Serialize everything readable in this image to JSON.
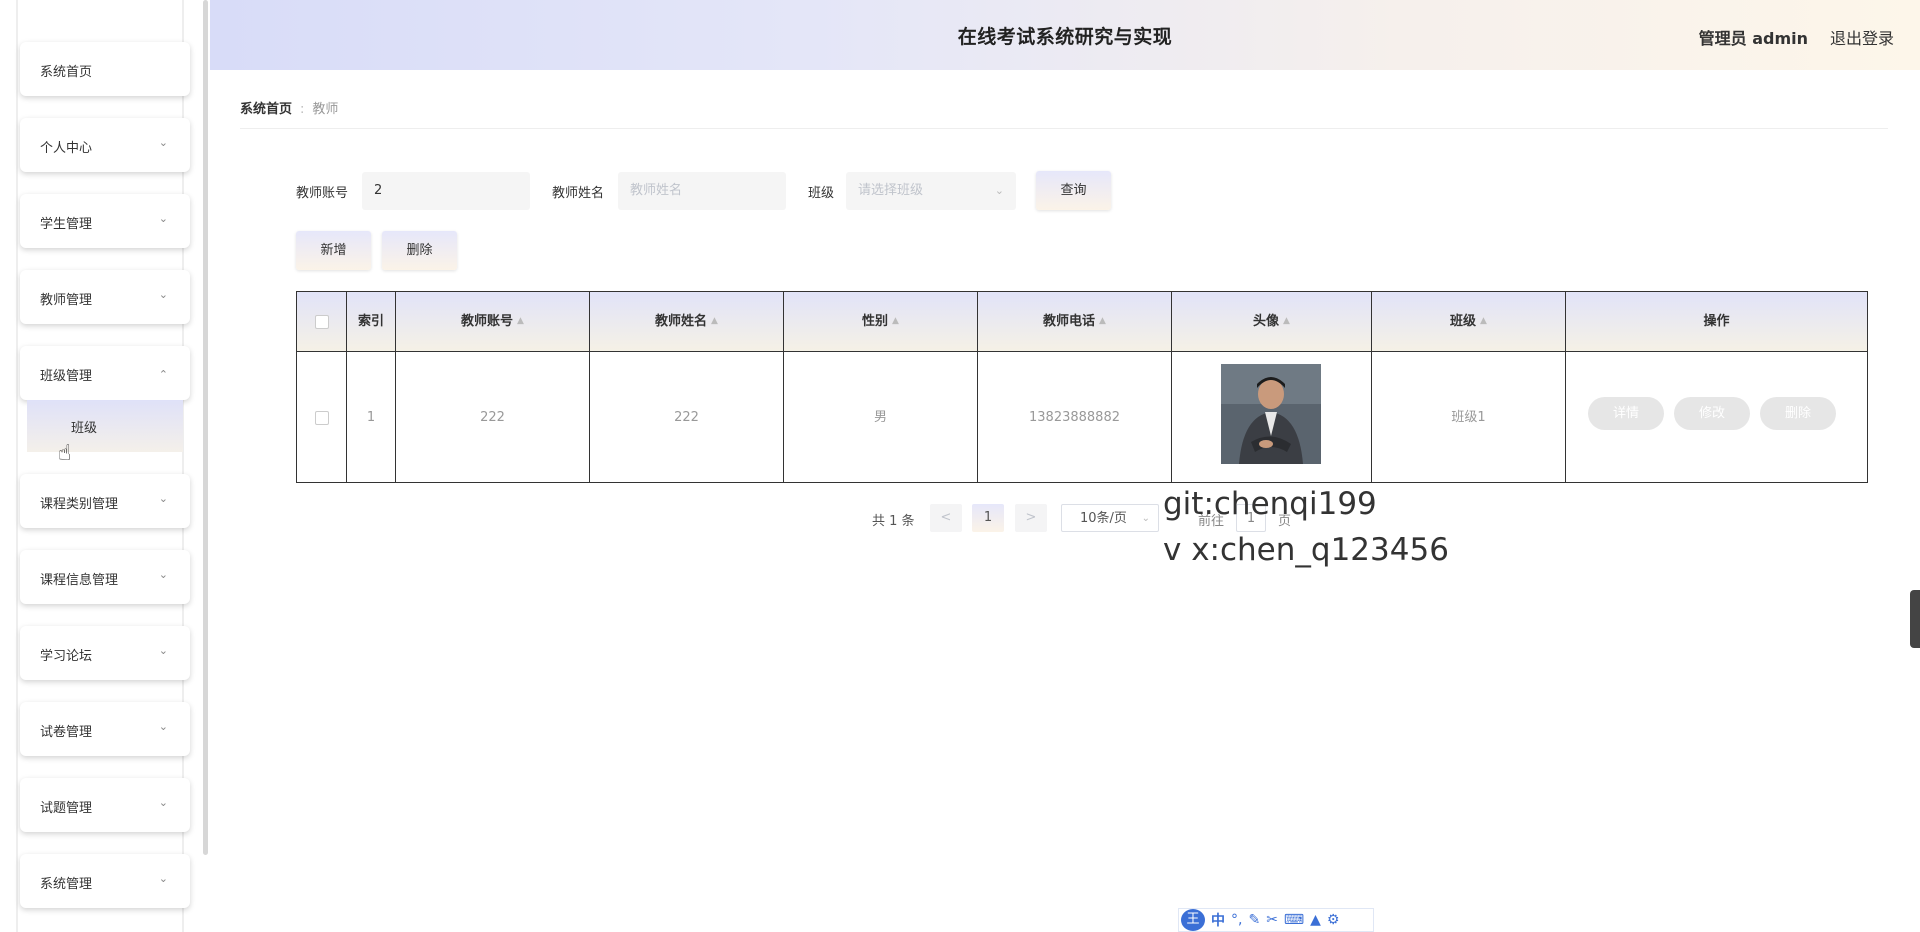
{
  "header": {
    "title": "在线考试系统研究与实现",
    "user_label": "管理员 admin",
    "logout_label": "退出登录"
  },
  "sidebar": {
    "items": [
      {
        "label": "系统首页",
        "has_chevron": false
      },
      {
        "label": "个人中心",
        "has_chevron": true
      },
      {
        "label": "学生管理",
        "has_chevron": true
      },
      {
        "label": "教师管理",
        "has_chevron": true
      },
      {
        "label": "班级管理",
        "has_chevron": true,
        "expanded": true
      },
      {
        "label": "课程类别管理",
        "has_chevron": true
      },
      {
        "label": "课程信息管理",
        "has_chevron": true
      },
      {
        "label": "学习论坛",
        "has_chevron": true
      },
      {
        "label": "试卷管理",
        "has_chevron": true
      },
      {
        "label": "试题管理",
        "has_chevron": true
      },
      {
        "label": "系统管理",
        "has_chevron": true
      }
    ],
    "subitem": {
      "label": "班级"
    }
  },
  "breadcrumb": {
    "home": "系统首页",
    "separator": ":",
    "current": "教师"
  },
  "search": {
    "account_label": "教师账号",
    "account_value": "2",
    "name_label": "教师姓名",
    "name_placeholder": "教师姓名",
    "class_label": "班级",
    "class_placeholder": "请选择班级",
    "query_button": "查询"
  },
  "actions": {
    "add_button": "新增",
    "delete_button": "删除"
  },
  "table": {
    "headers": [
      "索引",
      "教师账号",
      "教师姓名",
      "性别",
      "教师电话",
      "头像",
      "班级",
      "操作"
    ],
    "rows": [
      {
        "index": "1",
        "account": "222",
        "name": "222",
        "gender": "男",
        "phone": "13823888882",
        "avatar": "teacher-photo",
        "class": "班级1"
      }
    ],
    "row_buttons": [
      "详情",
      "修改",
      "删除"
    ]
  },
  "pagination": {
    "total": "共 1 条",
    "prev": "<",
    "current_page": "1",
    "next": ">",
    "page_size": "10条/页",
    "goto_label": "前往",
    "goto_value": "1",
    "page_suffix": "页"
  },
  "watermark": {
    "line1": "git:chenqi199",
    "line2": "v x:chen_q123456"
  },
  "ime_toolbar": {
    "logo": "王",
    "mode": "中",
    "icons": [
      "punct-icon",
      "pen-icon",
      "scissors-icon",
      "keyboard-icon",
      "shirt-icon",
      "gear-icon"
    ]
  },
  "colors": {
    "header_left": "#d8dcf8",
    "header_right": "#fdf6ea",
    "table_border": "#333333",
    "ime_blue": "#3b6fd6"
  }
}
